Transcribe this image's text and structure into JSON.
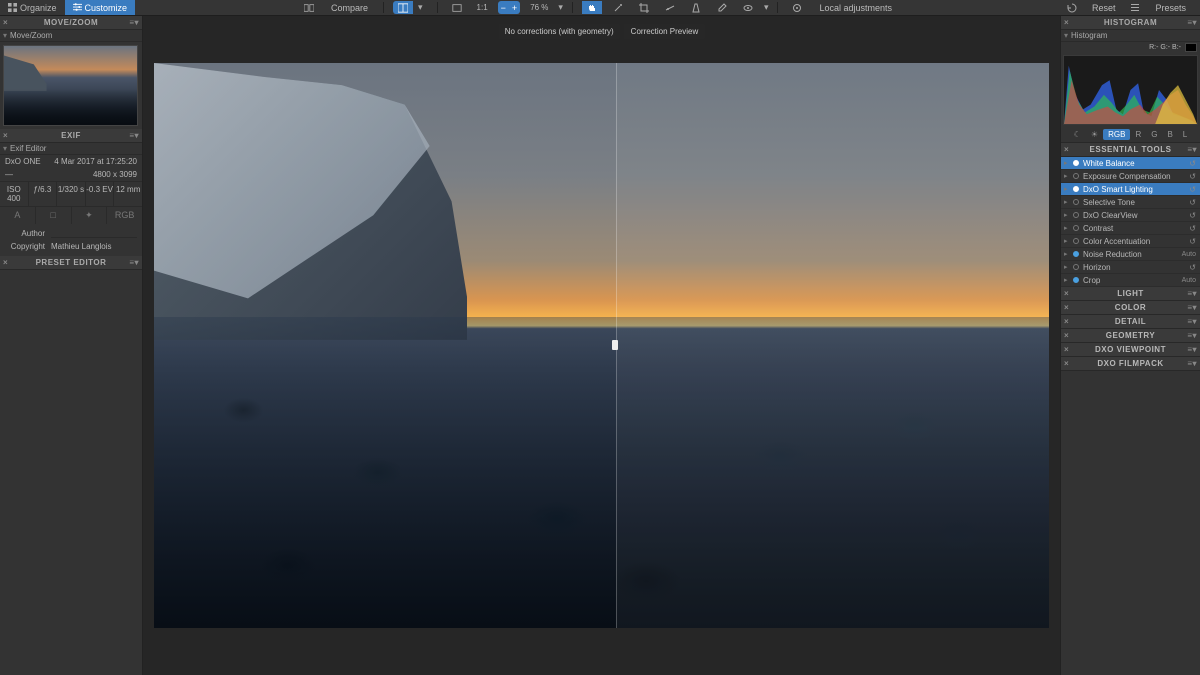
{
  "topbar": {
    "tabs": {
      "organize": "Organize",
      "customize": "Customize"
    },
    "compare": "Compare",
    "zoom_pct": "76 %",
    "ratio": "1:1",
    "local_adjustments": "Local adjustments",
    "reset": "Reset",
    "presets": "Presets"
  },
  "compare_labels": {
    "left": "No corrections (with geometry)",
    "right": "Correction Preview"
  },
  "left": {
    "movezoom": {
      "title": "MOVE/ZOOM",
      "sub": "Move/Zoom"
    },
    "exif": {
      "title": "EXIF",
      "sub": "Exif Editor",
      "camera": "DxO ONE",
      "datetime": "4 Mar 2017 at 17:25:20",
      "dash": "—",
      "dims": "4800 x 3099",
      "cells": [
        "ISO 400",
        "ƒ/6.3",
        "1/320 s",
        "-0.3 EV",
        "12 mm"
      ],
      "icons": [
        "A",
        "□",
        "✦",
        "RGB"
      ],
      "author_label": "Author",
      "copyright_label": "Copyright",
      "copyright_value": "Mathieu Langlois"
    },
    "preset_editor": {
      "title": "PRESET EDITOR"
    }
  },
  "right": {
    "histogram": {
      "title": "HISTOGRAM",
      "sub": "Histogram",
      "readout": "R:- G:- B:-",
      "channels": [
        "☾",
        "☀",
        "RGB",
        "R",
        "G",
        "B",
        "L"
      ]
    },
    "essential": {
      "title": "ESSENTIAL TOOLS",
      "items": [
        {
          "label": "White Balance",
          "on": true,
          "hl": true
        },
        {
          "label": "Exposure Compensation",
          "on": false
        },
        {
          "label": "DxO Smart Lighting",
          "on": true,
          "hl": true
        },
        {
          "label": "Selective Tone",
          "on": false
        },
        {
          "label": "DxO ClearView",
          "on": false
        },
        {
          "label": "Contrast",
          "on": false
        },
        {
          "label": "Color Accentuation",
          "on": false
        },
        {
          "label": "Noise Reduction",
          "on": true,
          "auto": "Auto"
        },
        {
          "label": "Horizon",
          "on": false
        },
        {
          "label": "Crop",
          "on": true,
          "auto": "Auto"
        }
      ]
    },
    "sections": [
      "LIGHT",
      "COLOR",
      "DETAIL",
      "GEOMETRY",
      "DXO VIEWPOINT",
      "DXO FILMPACK"
    ]
  }
}
